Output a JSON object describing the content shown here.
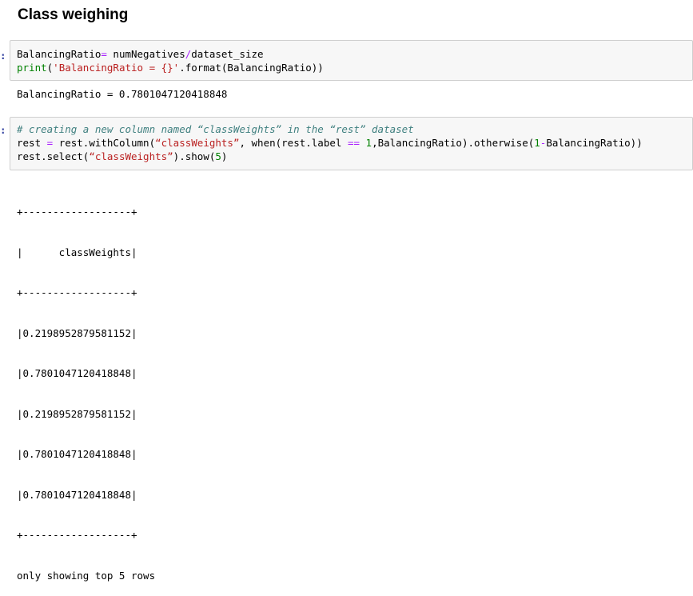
{
  "heading": "Class weighing",
  "cells": [
    {
      "prompt": ":",
      "code": {
        "line1": {
          "a": "BalancingRatio",
          "eq": "=",
          "b": " numNegatives",
          "slash": "/",
          "c": "dataset_size"
        },
        "line2": {
          "fn": "print",
          "p1": "(",
          "s": "'BalancingRatio = {}'",
          "rest": ".format(BalancingRatio))"
        }
      },
      "output": "BalancingRatio = 0.7801047120418848"
    },
    {
      "prompt": ":",
      "code": {
        "comment": "# creating a new column named “classWeights” in the “rest” dataset",
        "line2": {
          "a": "rest ",
          "eq": "=",
          "b": " rest.withColumn(",
          "s1": "“classWeights”",
          "c": ", when(rest.label ",
          "eqeq": "==",
          "d": " ",
          "n1": "1",
          "e": ",BalancingRatio).otherwise(",
          "n2": "1",
          "minus": "-",
          "f": "BalancingRatio))"
        },
        "line3": {
          "a": "rest.select(",
          "s": "“classWeights”",
          "b": ").show(",
          "n": "5",
          "c": ")"
        }
      },
      "output": {
        "border": "+------------------+",
        "header": "|      classWeights|",
        "rows": [
          "|0.2198952879581152|",
          "|0.7801047120418848|",
          "|0.2198952879581152|",
          "|0.7801047120418848|",
          "|0.7801047120418848|"
        ],
        "footer": "only showing top 5 rows"
      }
    }
  ]
}
